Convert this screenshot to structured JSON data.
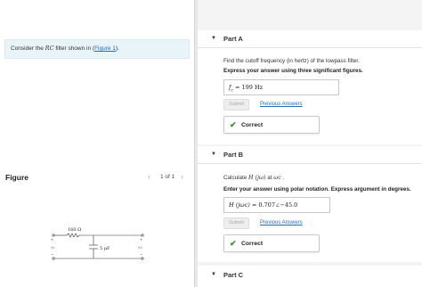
{
  "left": {
    "intro_prefix": "Consider the ",
    "intro_rc": "RC",
    "intro_middle": " filter shown in (",
    "intro_link": "Figure 1",
    "intro_suffix": ").",
    "figure_title": "Figure",
    "figure_prev": "‹",
    "figure_counter": "1 of 1",
    "figure_next": "›",
    "circuit": {
      "resistor_label": "160 Ω",
      "capacitor_label": "5 μF",
      "input_label": "v₁",
      "output_label": "v₂",
      "plus_sign": "+",
      "minus_sign": "−"
    }
  },
  "parts": {
    "a": {
      "title": "Part A",
      "caret": "▼",
      "question": "Find the cutoff frequency (in hertz) of the lowpass filter.",
      "instruction": "Express your answer using three significant figures.",
      "answer_var": "f",
      "answer_sub": "c",
      "answer_eq": " =  199  ",
      "answer_unit": "Hz",
      "submit_label": "Submit",
      "prev_answers_label": "Previous Answers",
      "result_icon": "✔",
      "result_label": "Correct"
    },
    "b": {
      "title": "Part B",
      "caret": "▼",
      "question_prefix": "Calculate ",
      "question_math": "H (jω)",
      "question_mid": " at ",
      "question_math2": "ωc",
      "question_suffix": " .",
      "instruction": "Enter your answer using polar notation. Express argument in degrees.",
      "answer_lhs": "H (jωc)",
      "answer_eq": " =  0.707∠−45.0",
      "submit_label": "Submit",
      "prev_answers_label": "Previous Answers",
      "result_icon": "✔",
      "result_label": "Correct"
    },
    "c": {
      "title": "Part C",
      "caret": "▼"
    }
  },
  "colors": {
    "link": "#1d6fb8",
    "correct_check": "#3f8f29",
    "intro_bg": "#e8f4f8"
  }
}
